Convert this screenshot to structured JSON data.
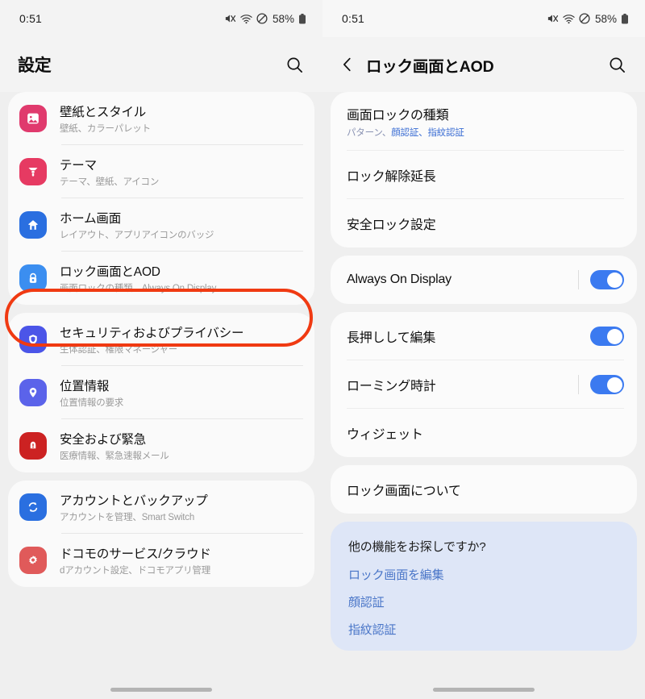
{
  "status": {
    "time": "0:51",
    "battery_percent": "58%",
    "icons": [
      "mute-icon",
      "wifi-icon",
      "do-not-disturb-icon",
      "battery-icon"
    ]
  },
  "colors": {
    "accent_blue": "#3b7af0",
    "annotation_red": "#f03a12",
    "link_blue": "#4a76c8",
    "info_card_bg": "#dee6f7",
    "page_bg": "#efefef",
    "card_bg": "#fafafa"
  },
  "left_panel": {
    "title": "設定",
    "search_icon": "search-icon",
    "groups": [
      {
        "items": [
          {
            "title": "壁紙とスタイル",
            "subtitle": "壁紙、カラーパレット",
            "icon": "wallpaper-icon",
            "icon_color": "#e03a6d"
          },
          {
            "title": "テーマ",
            "subtitle": "テーマ、壁紙、アイコン",
            "icon": "theme-brush-icon",
            "icon_color": "#e63a62"
          },
          {
            "title": "ホーム画面",
            "subtitle": "レイアウト、アプリアイコンのバッジ",
            "icon": "home-icon",
            "icon_color": "#2a6fe0"
          },
          {
            "title": "ロック画面とAOD",
            "subtitle": "画面ロックの種類、Always On Display",
            "icon": "lock-icon",
            "icon_color": "#3b8ef0",
            "highlighted": true
          }
        ]
      },
      {
        "items": [
          {
            "title": "セキュリティおよびプライバシー",
            "subtitle": "生体認証、権限マネージャー",
            "icon": "shield-icon",
            "icon_color": "#4b55e8"
          },
          {
            "title": "位置情報",
            "subtitle": "位置情報の要求",
            "icon": "location-pin-icon",
            "icon_color": "#5b63ea"
          },
          {
            "title": "安全および緊急",
            "subtitle": "医療情報、緊急速報メール",
            "icon": "emergency-alert-icon",
            "icon_color": "#cc2222"
          }
        ]
      },
      {
        "items": [
          {
            "title": "アカウントとバックアップ",
            "subtitle": "アカウントを管理、Smart Switch",
            "icon": "sync-icon",
            "icon_color": "#2a6fe0"
          },
          {
            "title": "ドコモのサービス/クラウド",
            "subtitle": "dアカウント設定、ドコモアプリ管理",
            "icon": "gear-icon",
            "icon_color": "#e05a5a"
          }
        ]
      }
    ]
  },
  "right_panel": {
    "title": "ロック画面とAOD",
    "back_icon": "back-chevron-icon",
    "search_icon": "search-icon",
    "groups": [
      {
        "items": [
          {
            "title": "画面ロックの種類",
            "subtitle_dim": "パターン、",
            "subtitle_link": "顔認証、指紋認証",
            "type": "nav"
          },
          {
            "title": "ロック解除延長",
            "type": "nav"
          },
          {
            "title": "安全ロック設定",
            "type": "nav"
          }
        ]
      },
      {
        "items": [
          {
            "title": "Always On Display",
            "type": "toggle",
            "toggle_on": true,
            "has_divider": true,
            "highlighted": true
          }
        ]
      },
      {
        "items": [
          {
            "title": "長押しして編集",
            "type": "toggle",
            "toggle_on": true,
            "has_divider": false
          },
          {
            "title": "ローミング時計",
            "type": "toggle",
            "toggle_on": true,
            "has_divider": true
          },
          {
            "title": "ウィジェット",
            "type": "nav"
          }
        ]
      },
      {
        "items": [
          {
            "title": "ロック画面について",
            "type": "nav"
          }
        ]
      }
    ],
    "info_card": {
      "title": "他の機能をお探しですか?",
      "links": [
        "ロック画面を編集",
        "顔認証",
        "指紋認証"
      ]
    }
  }
}
